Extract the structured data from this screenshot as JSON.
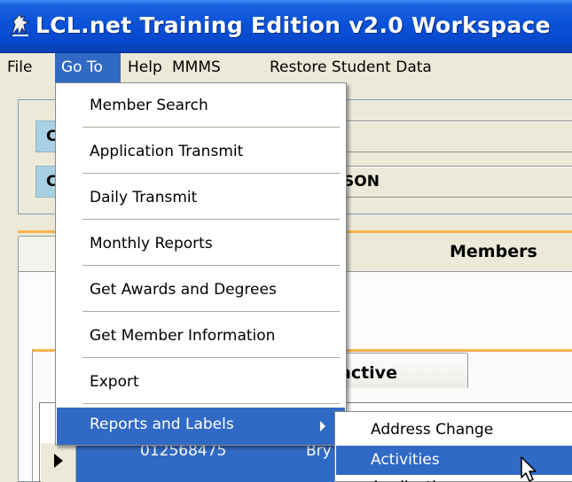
{
  "window": {
    "title": "LCL.net Training Edition v2.0 Workspace",
    "icon": "lcl-logo-icon"
  },
  "menubar": {
    "items": [
      "File",
      "Go To",
      "Help",
      "MMMS",
      "Restore Student Data"
    ],
    "active": "Go To"
  },
  "goto_menu": {
    "items": [
      "Member Search",
      "Application Transmit",
      "Daily Transmit",
      "Monthly Reports",
      "Get Awards and Degrees",
      "Get Member Information",
      "Export",
      "Reports and Labels"
    ],
    "highlighted": "Reports and Labels"
  },
  "reports_submenu": {
    "items": [
      "Address Change",
      "Activities",
      "Applications"
    ],
    "highlighted": "Activities"
  },
  "workspace": {
    "field1_label": "C",
    "field2_label": "C",
    "field2_value": "SON",
    "tab_members": "Members",
    "tab_inactive": "active",
    "selected_row": {
      "id": "012568475",
      "name": "Bry"
    }
  },
  "colors": {
    "titlebar": "#0a52d8",
    "highlight": "#316ac5",
    "menu_bg": "#ece9d8",
    "tab_accent": "#f8b34d"
  }
}
